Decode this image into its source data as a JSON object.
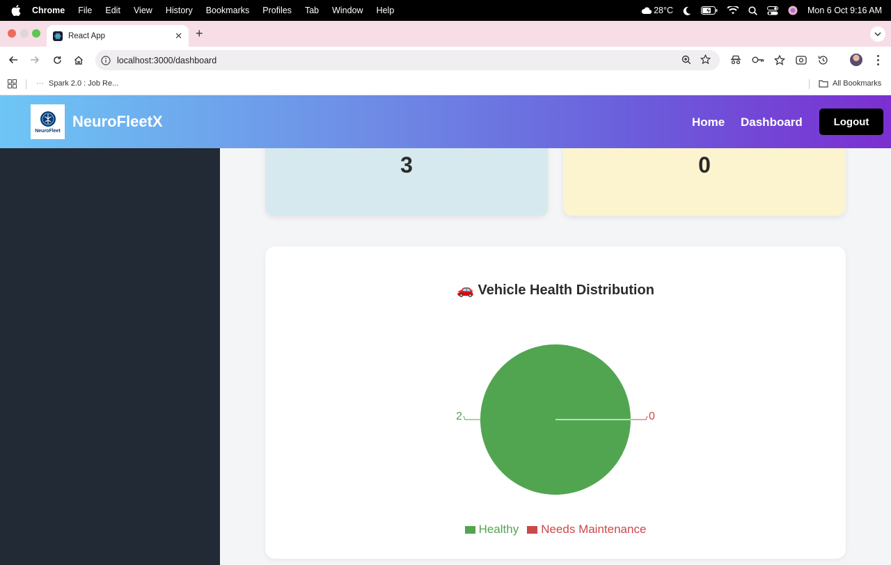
{
  "menubar": {
    "app": "Chrome",
    "items": [
      "File",
      "Edit",
      "View",
      "History",
      "Bookmarks",
      "Profiles",
      "Tab",
      "Window",
      "Help"
    ],
    "weather": "28°C",
    "clock": "Mon 6 Oct  9:16 AM"
  },
  "browser": {
    "tab_title": "React App",
    "url": "localhost:3000/dashboard",
    "bookmark": "Spark 2.0 : Job Re...",
    "all_bookmarks": "All Bookmarks"
  },
  "header": {
    "logo_text": "NeuroFleet",
    "brand": "NeuroFleetX",
    "nav": {
      "home": "Home",
      "dashboard": "Dashboard",
      "logout": "Logout"
    }
  },
  "stats": [
    {
      "value": "3",
      "color": "#d6e9ef"
    },
    {
      "value": "0",
      "color": "#fbf4cf"
    }
  ],
  "chart_card": {
    "title": "🚗 Vehicle Health Distribution"
  },
  "chart_data": {
    "type": "pie",
    "title": "🚗 Vehicle Health Distribution",
    "categories": [
      "Healthy",
      "Needs Maintenance"
    ],
    "values": [
      2,
      0
    ],
    "colors": [
      "#52a550",
      "#cc4848"
    ],
    "legend_position": "bottom"
  }
}
